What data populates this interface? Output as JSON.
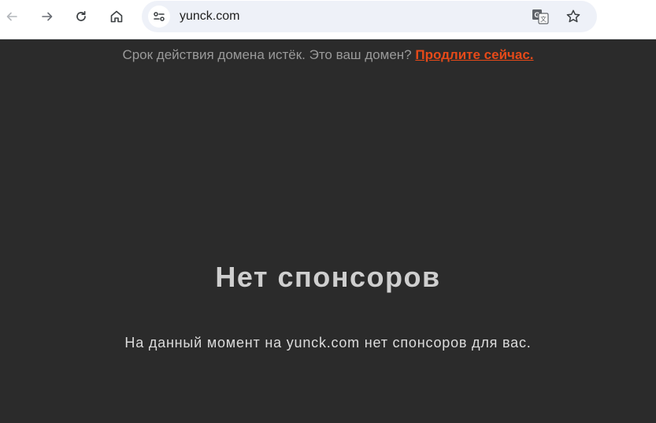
{
  "browser": {
    "url": "yunck.com",
    "icons": {
      "back": "back-arrow-icon",
      "forward": "forward-arrow-icon",
      "reload": "reload-icon",
      "home": "home-icon",
      "site_info": "tune-icon",
      "translate": "translate-icon",
      "bookmark": "star-icon"
    }
  },
  "page": {
    "expiry_text": "Срок действия домена истёк. Это ваш домен?",
    "renew_link": "Продлите сейчас.",
    "title": "Нет спонсоров",
    "subtitle": "На данный момент на yunck.com нет спонсоров для вас."
  },
  "colors": {
    "page_background": "#2b2b2b",
    "link": "#e64a19",
    "title": "#cfcfcf",
    "muted_text": "#9a9a9a"
  }
}
